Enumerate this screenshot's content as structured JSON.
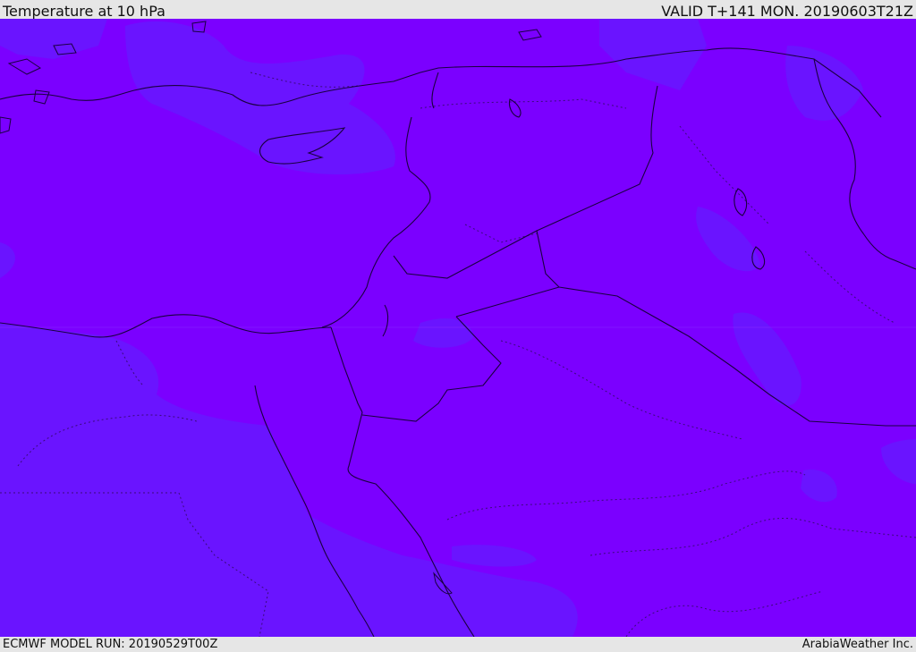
{
  "header": {
    "title": "Temperature at 10 hPa",
    "valid": "VALID T+141 MON. 20190603T21Z"
  },
  "footer": {
    "model_run": "ECMWF MODEL RUN: 20190529T00Z",
    "credit": "ArabiaWeather Inc."
  },
  "map": {
    "region": "Eastern Mediterranean and Arabian Peninsula",
    "fill_colors": {
      "warm_field": "#7b00ff",
      "cool_field": "#6a12ff",
      "border_line": "#1a0040",
      "admin_line": "#3a0a7a"
    }
  }
}
